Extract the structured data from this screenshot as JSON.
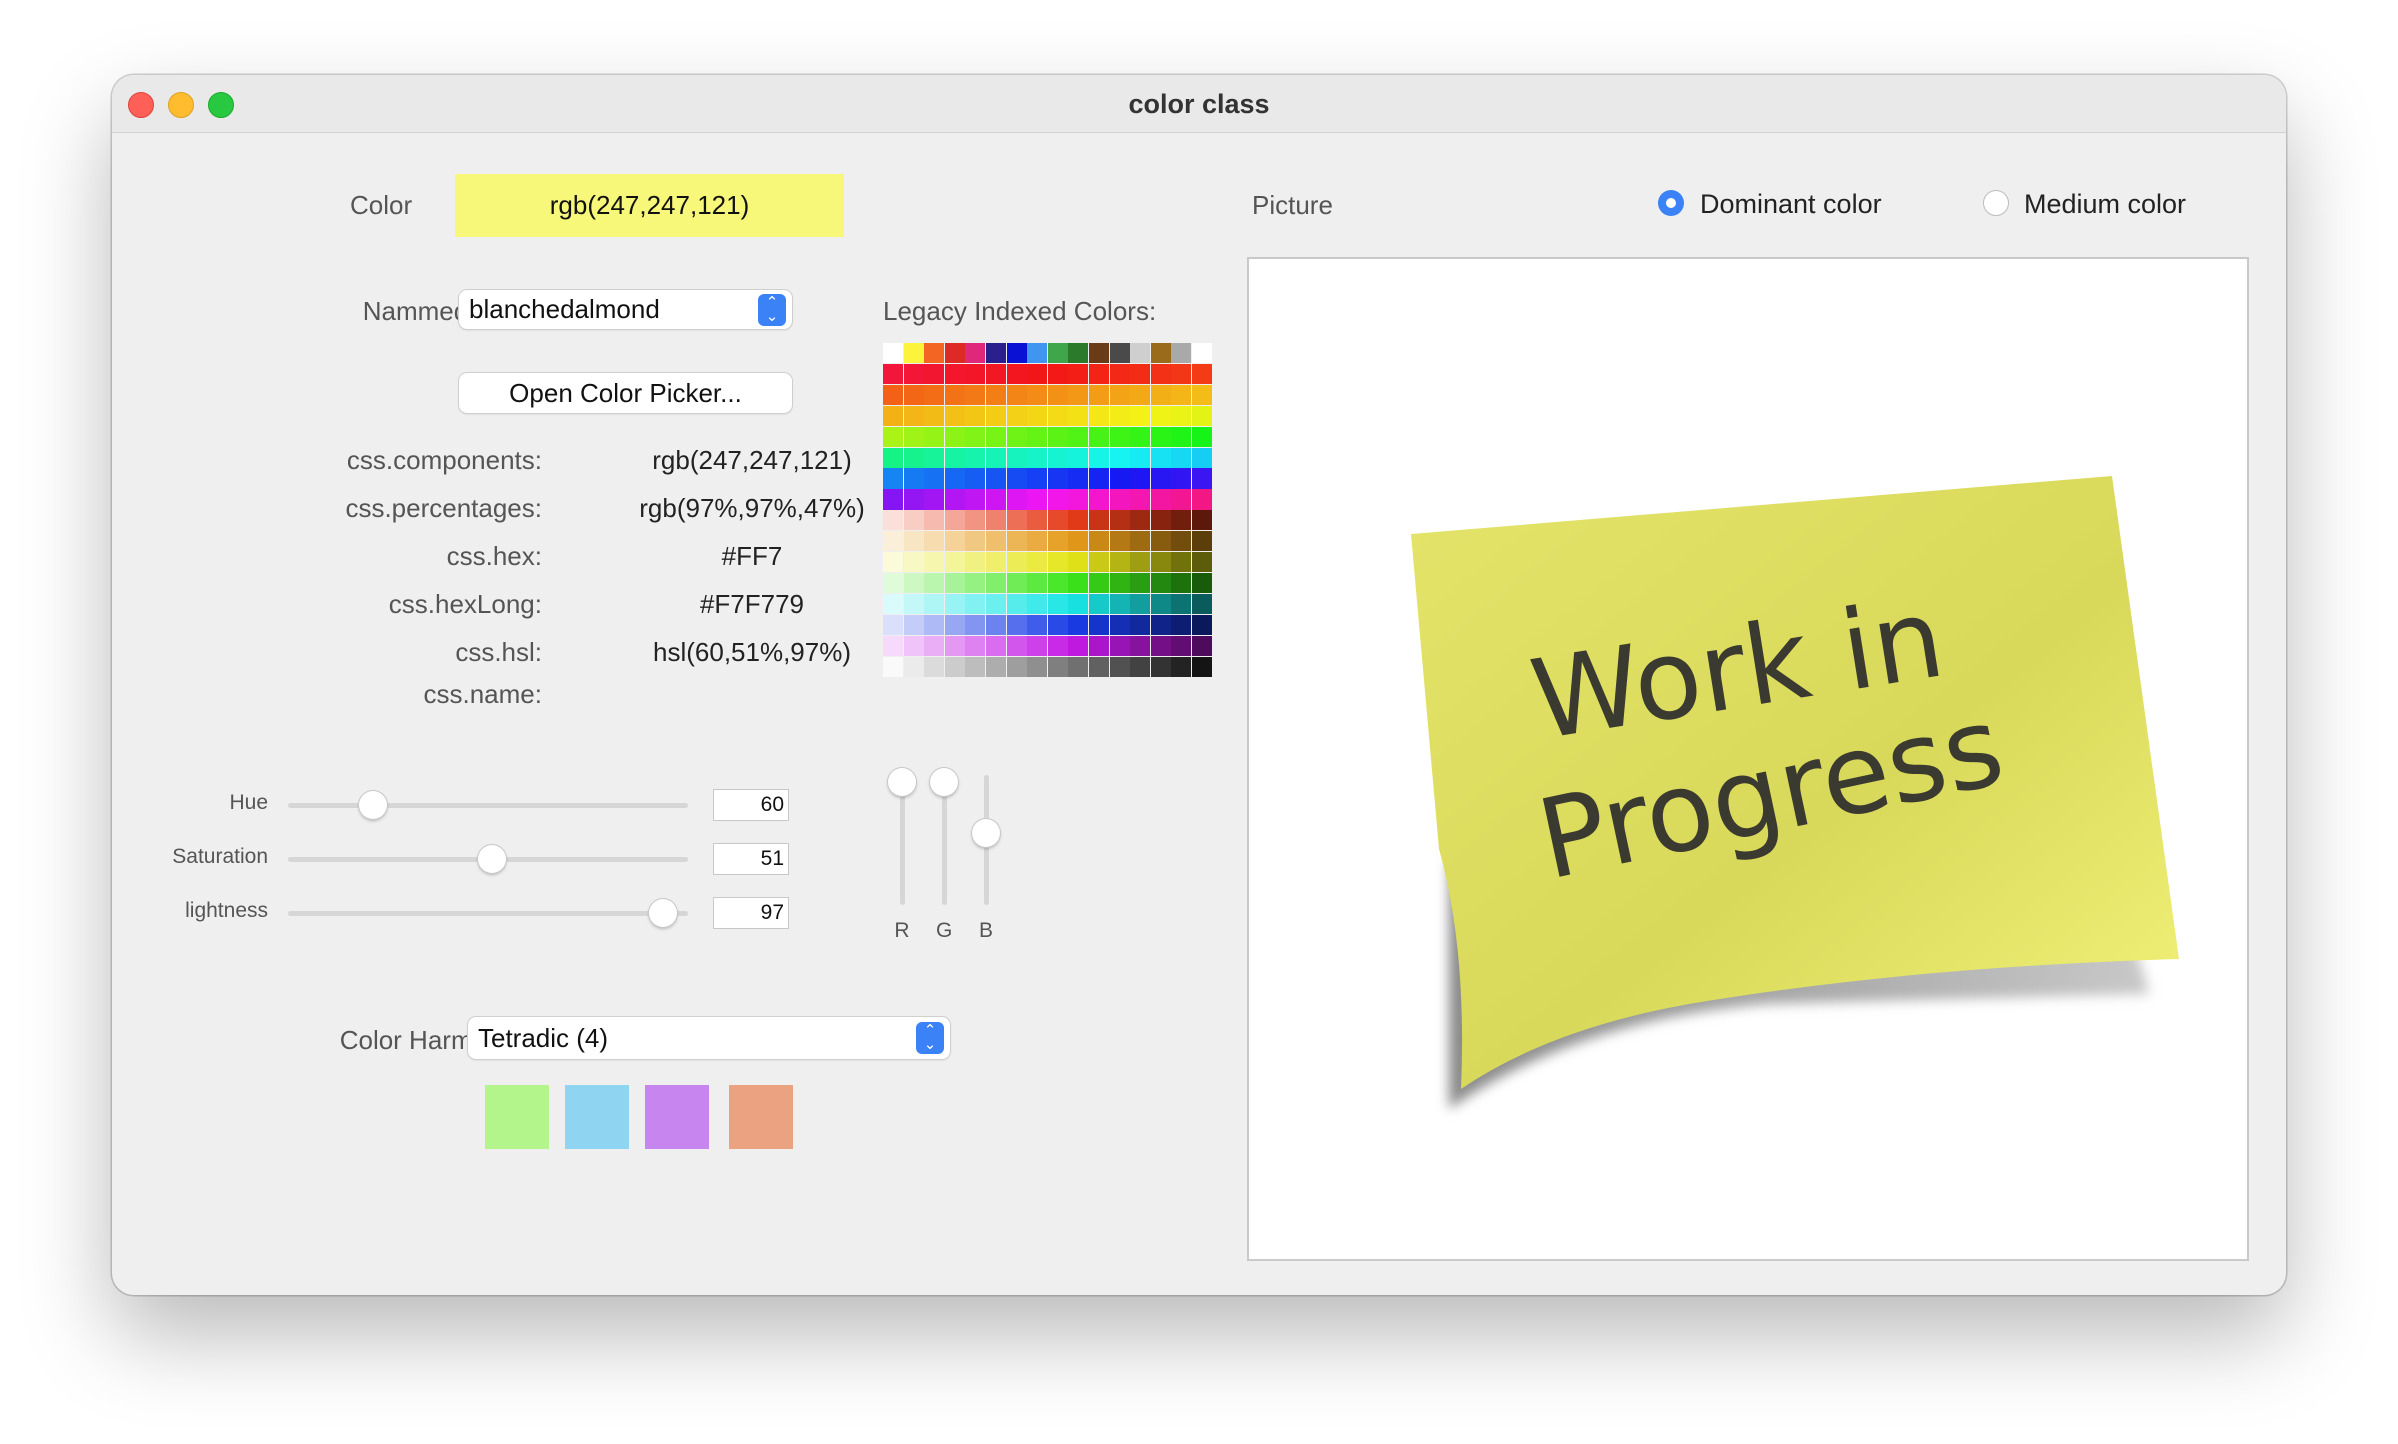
{
  "window": {
    "title": "color class"
  },
  "color": {
    "label": "Color",
    "value": "rgb(247,247,121)",
    "swatch": "#f7f779"
  },
  "named_colors": {
    "label": "Nammed colors:",
    "selected": "blanchedalmond"
  },
  "open_picker_label": "Open Color Picker...",
  "css_rows": [
    {
      "label": "css.components:",
      "value": "rgb(247,247,121)"
    },
    {
      "label": "css.percentages:",
      "value": "rgb(97%,97%,47%)"
    },
    {
      "label": "css.hex:",
      "value": "#FF7"
    },
    {
      "label": "css.hexLong:",
      "value": "#F7F779"
    },
    {
      "label": "css.hsl:",
      "value": "hsl(60,51%,97%)"
    },
    {
      "label": "css.name:",
      "value": ""
    }
  ],
  "hsl_sliders": [
    {
      "label": "Hue",
      "value": "60",
      "fraction": 0.19
    },
    {
      "label": "Saturation",
      "value": "51",
      "fraction": 0.51
    },
    {
      "label": "lightness",
      "value": "97",
      "fraction": 0.97
    }
  ],
  "rgb_sliders": [
    {
      "label": "R",
      "value": 247,
      "fraction": 0.97
    },
    {
      "label": "G",
      "value": 247,
      "fraction": 0.97
    },
    {
      "label": "B",
      "value": 121,
      "fraction": 0.47
    }
  ],
  "legacy": {
    "label": "Legacy Indexed Colors:"
  },
  "harmonies": {
    "label": "Color Harmonies:",
    "selected": "Tetradic (4)",
    "swatches": [
      "#b3f58b",
      "#8fd5f2",
      "#c785ef",
      "#eba280"
    ]
  },
  "picture": {
    "label": "Picture",
    "options": [
      {
        "label": "Dominant color",
        "selected": true
      },
      {
        "label": "Medium color",
        "selected": false
      }
    ],
    "note_text_line1": "Work in",
    "note_text_line2": "Progress"
  }
}
